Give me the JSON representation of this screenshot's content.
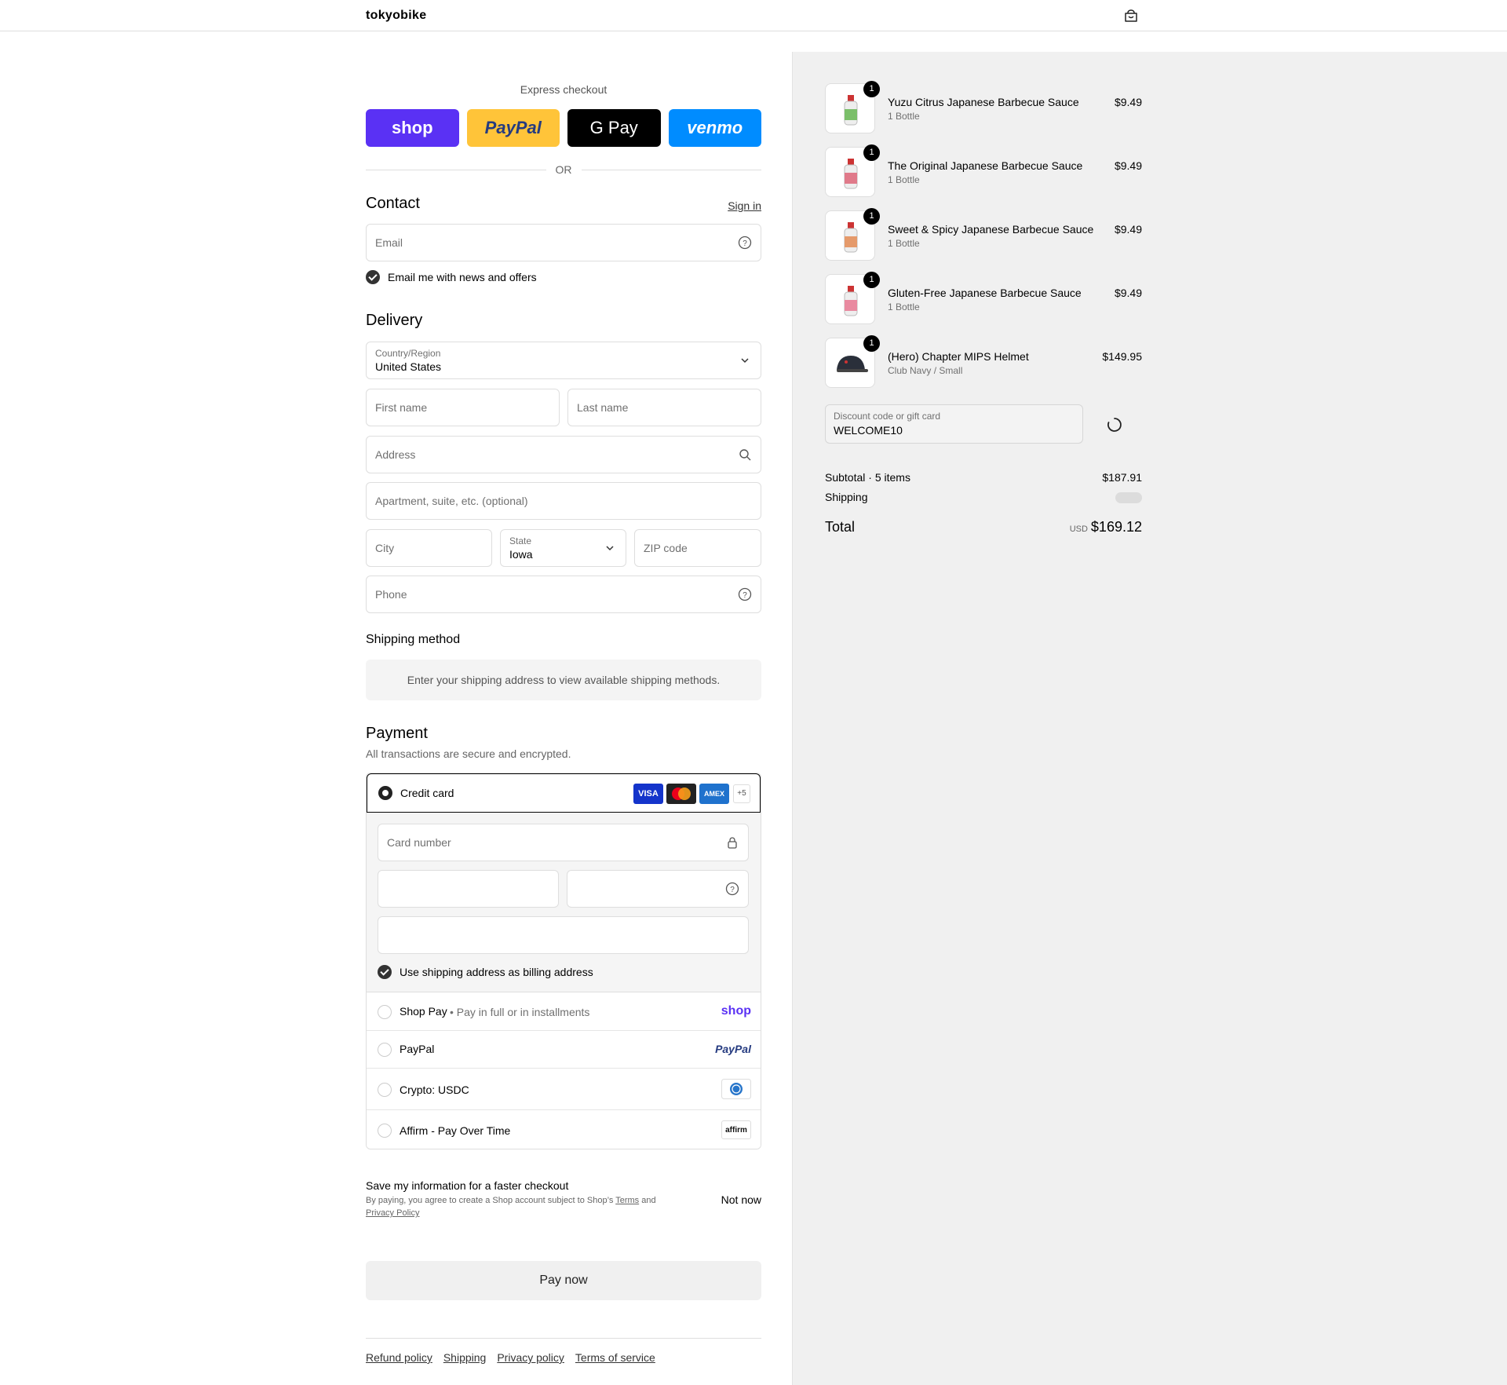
{
  "header": {
    "brand": "tokyobike"
  },
  "express": {
    "title": "Express checkout",
    "shop_label": "shop",
    "paypal_label": "PayPal",
    "gpay_label": "G Pay",
    "venmo_label": "venmo",
    "or_label": "OR"
  },
  "contact": {
    "heading": "Contact",
    "sign_in": "Sign in",
    "email_placeholder": "Email",
    "news_label": "Email me with news and offers"
  },
  "delivery": {
    "heading": "Delivery",
    "country_label": "Country/Region",
    "country_value": "United States",
    "first_name": "First name",
    "last_name": "Last name",
    "address": "Address",
    "apartment": "Apartment, suite, etc. (optional)",
    "city": "City",
    "state_label": "State",
    "state_value": "Iowa",
    "zip": "ZIP code",
    "phone": "Phone"
  },
  "shipping": {
    "heading": "Shipping method",
    "note": "Enter your shipping address to view available shipping methods."
  },
  "payment": {
    "heading": "Payment",
    "subheading": "All transactions are secure and encrypted.",
    "credit_card": "Credit card",
    "more_cards": "+5",
    "card_number": "Card number",
    "billing_same": "Use shipping address as billing address",
    "shop_pay": "Shop Pay",
    "shop_pay_sub": "• Pay in full or in installments",
    "shop_pay_logo": "shop",
    "paypal": "PayPal",
    "paypal_logo": "PayPal",
    "crypto": "Crypto: USDC",
    "affirm": "Affirm - Pay Over Time",
    "affirm_logo": "affirm"
  },
  "save": {
    "title": "Save my information for a faster checkout",
    "sub_prefix": "By paying, you agree to create a Shop account subject to Shop’s ",
    "terms": "Terms",
    "and": " and",
    "privacy": "Privacy Policy",
    "not_now": "Not now"
  },
  "pay_now": "Pay now",
  "footer": {
    "refund": "Refund policy",
    "shipping": "Shipping",
    "privacy": "Privacy policy",
    "terms": "Terms of service"
  },
  "cart": {
    "items": [
      {
        "qty": "1",
        "name": "Yuzu Citrus Japanese Barbecue Sauce",
        "variant": "1 Bottle",
        "price": "$9.49",
        "color": "#7bbf6a"
      },
      {
        "qty": "1",
        "name": "The Original Japanese Barbecue Sauce",
        "variant": "1 Bottle",
        "price": "$9.49",
        "color": "#e07a8a"
      },
      {
        "qty": "1",
        "name": "Sweet & Spicy Japanese Barbecue Sauce",
        "variant": "1 Bottle",
        "price": "$9.49",
        "color": "#e59a6b"
      },
      {
        "qty": "1",
        "name": "Gluten-Free Japanese Barbecue Sauce",
        "variant": "1 Bottle",
        "price": "$9.49",
        "color": "#e98aa0"
      },
      {
        "qty": "1",
        "name": "(Hero) Chapter MIPS Helmet",
        "variant": "Club Navy / Small",
        "price": "$149.95",
        "color": "#2a2f3a"
      }
    ],
    "discount_label": "Discount code or gift card",
    "discount_value": "WELCOME10",
    "subtotal_label": "Subtotal · 5 items",
    "subtotal_value": "$187.91",
    "shipping_label": "Shipping",
    "total_label": "Total",
    "currency": "USD",
    "total_value": "$169.12"
  }
}
